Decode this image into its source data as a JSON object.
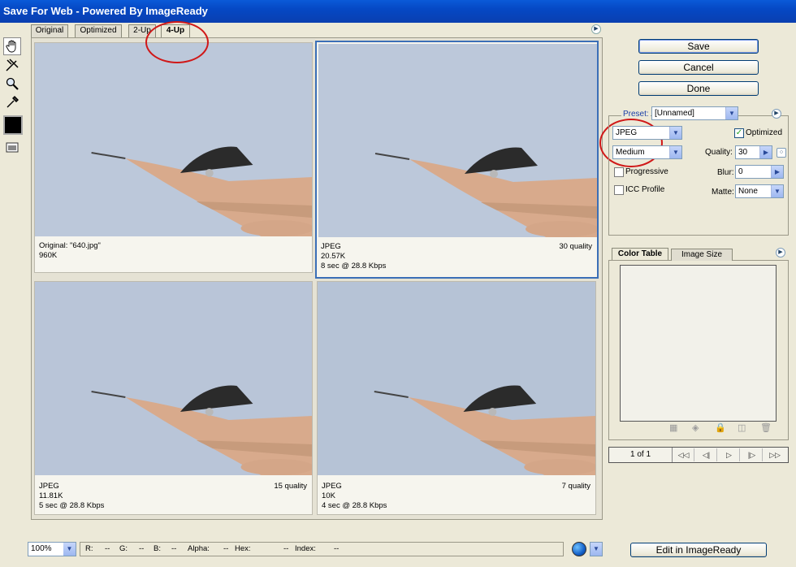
{
  "window": {
    "title": "Save For Web - Powered By ImageReady"
  },
  "tabs": [
    "Original",
    "Optimized",
    "2-Up",
    "4-Up"
  ],
  "panes": [
    {
      "line1": "Original: \"640.jpg\"",
      "line2": "960K",
      "line3": "",
      "quality": ""
    },
    {
      "line1": "JPEG",
      "line2": "20.57K",
      "line3": "8 sec @ 28.8 Kbps",
      "quality": "30 quality"
    },
    {
      "line1": "JPEG",
      "line2": "11.81K",
      "line3": "5 sec @ 28.8 Kbps",
      "quality": "15 quality"
    },
    {
      "line1": "JPEG",
      "line2": "10K",
      "line3": "4 sec @ 28.8 Kbps",
      "quality": "7 quality"
    }
  ],
  "buttons": {
    "save": "Save",
    "cancel": "Cancel",
    "done": "Done",
    "edit": "Edit in ImageReady"
  },
  "settings": {
    "preset_label": "Preset:",
    "preset_value": "[Unnamed]",
    "format": "JPEG",
    "quality_level": "Medium",
    "optimized_label": "Optimized",
    "optimized_checked": true,
    "quality_label": "Quality:",
    "quality_value": "30",
    "progressive_label": "Progressive",
    "blur_label": "Blur:",
    "blur_value": "0",
    "icc_label": "ICC Profile",
    "matte_label": "Matte:",
    "matte_value": "None"
  },
  "color_panel": {
    "tab1": "Color Table",
    "tab2": "Image Size"
  },
  "navigation": {
    "page": "1 of 1"
  },
  "statusbar": {
    "zoom": "100%",
    "r": "R:",
    "r_val": "--",
    "g": "G:",
    "g_val": "--",
    "b": "B:",
    "b_val": "--",
    "alpha": "Alpha:",
    "alpha_val": "--",
    "hex": "Hex:",
    "hex_val": "--",
    "index": "Index:",
    "index_val": "--"
  },
  "colors": {
    "title_bar": "#0548c4",
    "selection_border": "#3b6fb7",
    "annotation": "#d01818",
    "checkmark": "#21a121"
  }
}
